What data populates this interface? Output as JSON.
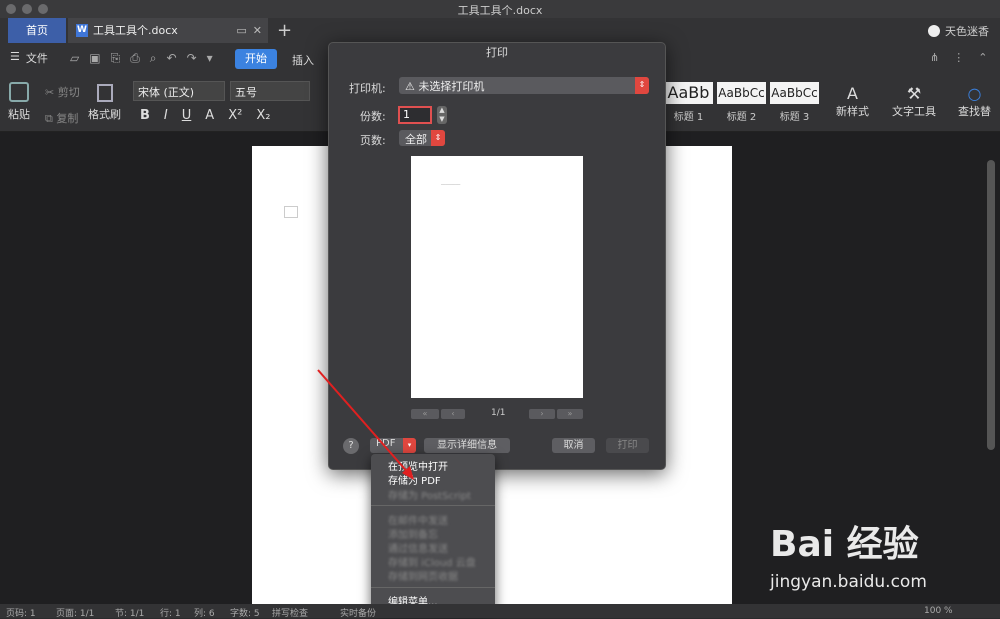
{
  "window": {
    "title": "工具工具个.docx"
  },
  "tabs": {
    "home": "首页",
    "doc": "工具工具个.docx",
    "new": "+",
    "user": "天色迷香"
  },
  "menu": {
    "file": "文件",
    "start": "开始",
    "insert": "插入"
  },
  "ribbon": {
    "paste": "粘贴",
    "cut": "剪切",
    "copy": "复制",
    "format_painter": "格式刷",
    "font": "宋体 (正文)",
    "size": "五号",
    "bold": "B",
    "italic": "I",
    "underline": "U",
    "fontcolor": "A",
    "sup": "X²",
    "sub": "X₂",
    "styles": [
      {
        "sample": "AaBb",
        "label": "标题 1"
      },
      {
        "sample": "AaBbCc",
        "label": "标题 2"
      },
      {
        "sample": "AaBbCc",
        "label": "标题 3"
      }
    ],
    "new_style": "新样式",
    "text_tools": "文字工具",
    "find": "查找替"
  },
  "dialog": {
    "title": "打印",
    "printer_label": "打印机:",
    "printer_value": "⚠ 未选择打印机",
    "copies_label": "份数:",
    "copies_value": "1",
    "pages_label": "页数:",
    "pages_value": "全部",
    "page_count": "1/1",
    "help": "?",
    "pdf": "PDF",
    "details": "显示详细信息",
    "cancel": "取消",
    "print": "打印"
  },
  "pdf_menu": {
    "items": [
      "在预览中打开",
      "存储为 PDF",
      "存储为 PostScript",
      "在邮件中发送",
      "添加到备忘",
      "通过信息发送",
      "存储到 iCloud 云盘",
      "存储到网页收据"
    ],
    "edit": "编辑菜单..."
  },
  "status": {
    "page": "页码: 1",
    "pages": "页面: 1/1",
    "section": "节: 1/1",
    "row": "行: 1",
    "col": "列: 6",
    "words": "字数: 5",
    "spell": "拼写检查",
    "backup": "实时备份",
    "zoom": "100 %"
  },
  "watermark": {
    "logo": "Bai 经验",
    "url": "jingyan.baidu.com"
  }
}
